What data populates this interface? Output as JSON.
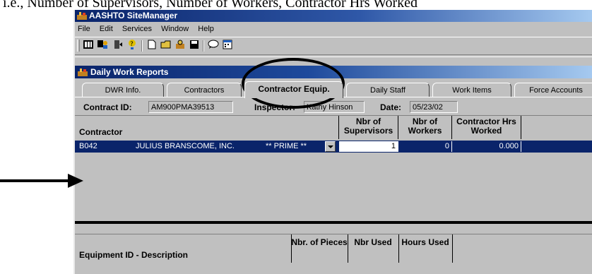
{
  "caption": "i.e., Number of Supervisors, Number of Workers, Contractor Hrs Worked",
  "window": {
    "title": "AASHTO SiteManager"
  },
  "menu": [
    "File",
    "Edit",
    "Services",
    "Window",
    "Help"
  ],
  "toolbar_icons": [
    "grid-icon",
    "users-icon",
    "door-icon",
    "help-icon",
    "new-document-icon",
    "open-folder-icon",
    "tools-icon",
    "save-icon",
    "comment-icon",
    "calendar-icon"
  ],
  "child_window": {
    "title": "Daily Work Reports"
  },
  "tabs": [
    "DWR Info.",
    "Contractors",
    "Contractor Equip.",
    "Daily Staff",
    "Work Items",
    "Force Accounts"
  ],
  "active_tab": "Contractor Equip.",
  "header": {
    "contract_label": "Contract ID:",
    "contract_value": "AM900PMA39513",
    "inspector_label": "Inspector:",
    "inspector_value": "Kathy Hinson",
    "date_label": "Date:",
    "date_value": "05/23/02"
  },
  "contractor_grid": {
    "columns": [
      "Contractor",
      "Nbr of Supervisors",
      "Nbr of Workers",
      "Contractor Hrs Worked"
    ],
    "rows": [
      {
        "code": "B042",
        "name": "JULIUS BRANSCOME, INC.",
        "tag": "** PRIME **",
        "supervisors": "1",
        "workers": "0",
        "hours": "0.000"
      }
    ]
  },
  "equipment_grid": {
    "columns": [
      "Equipment ID - Description",
      "Nbr. of Pieces",
      "Nbr Used",
      "Hours Used"
    ]
  },
  "colors": {
    "title_bar": "#0a246a",
    "selected_row": "#0a246a",
    "window_bg": "#c0c0c0"
  }
}
